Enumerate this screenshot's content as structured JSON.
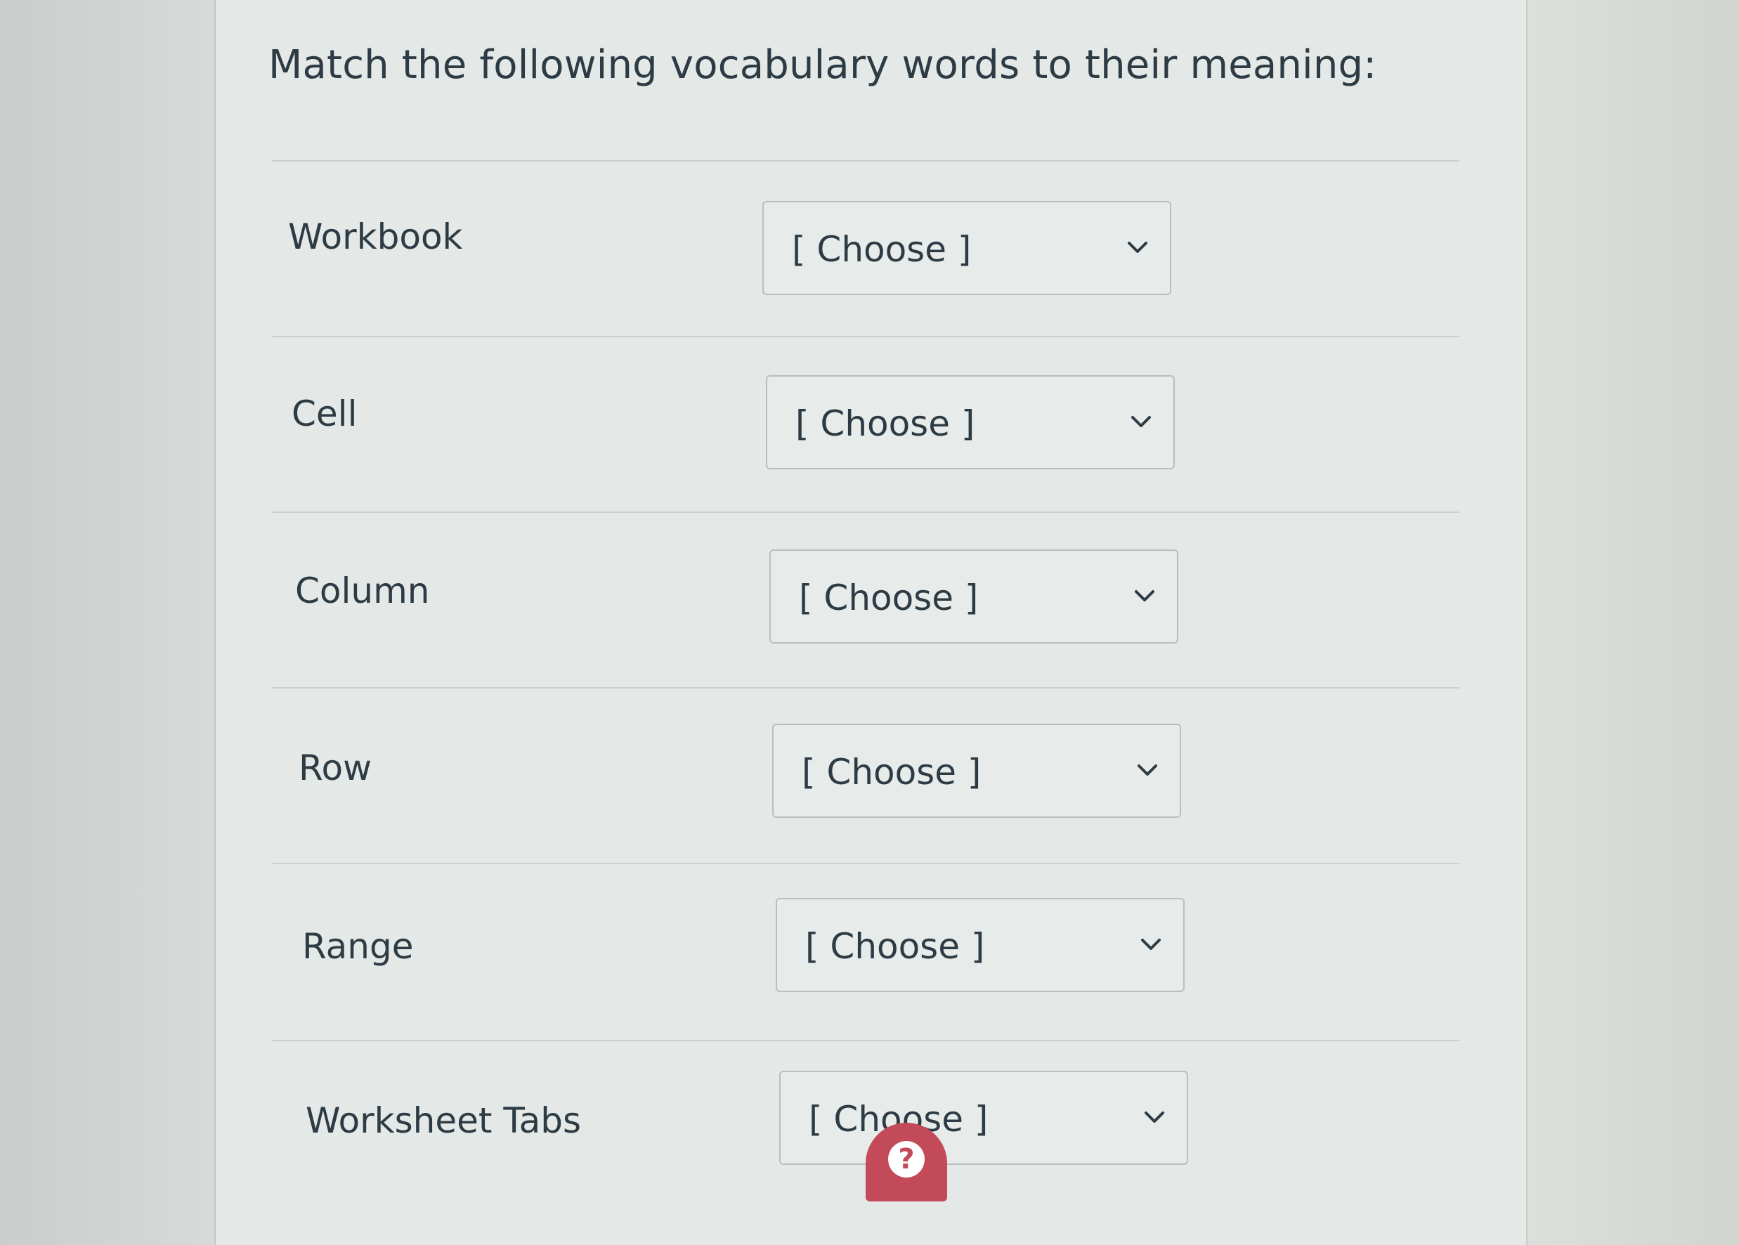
{
  "question": {
    "title": "Match the following vocabulary words to their meaning:"
  },
  "rows": [
    {
      "label": "Workbook",
      "select_value": "[ Choose ]"
    },
    {
      "label": "Cell",
      "select_value": "[ Choose ]"
    },
    {
      "label": "Column",
      "select_value": "[ Choose ]"
    },
    {
      "label": "Row",
      "select_value": "[ Choose ]"
    },
    {
      "label": "Range",
      "select_value": "[ Choose ]"
    },
    {
      "label": "Worksheet Tabs",
      "select_value": "[ Choose ]"
    }
  ],
  "icons": {
    "select_chevron": "chevron-down-icon",
    "help": "question-mark-icon"
  },
  "colors": {
    "text": "#2d3b45",
    "help_button": "#c24a59",
    "select_border": "#b8bfc3"
  }
}
